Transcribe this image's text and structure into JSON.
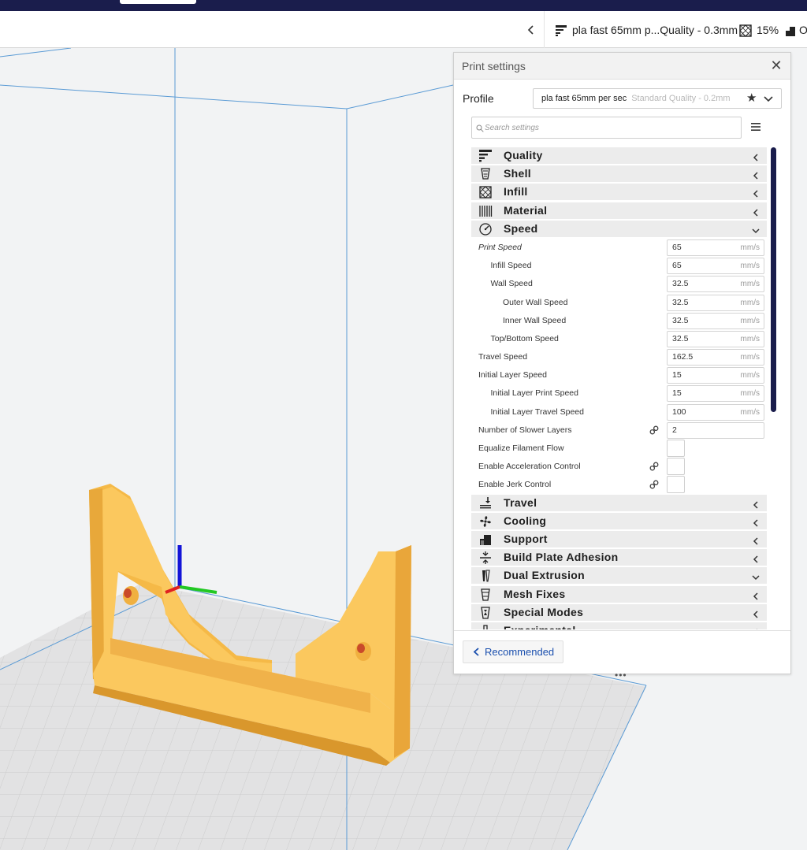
{
  "header": {
    "profile_summary": "pla fast 65mm p...Quality - 0.3mm",
    "infill_percent": "15%",
    "support_cut": "O"
  },
  "panel": {
    "title": "Print settings",
    "profile_label": "Profile",
    "profile_name": "pla fast 65mm per sec",
    "profile_sub": "Standard Quality - 0.2mm",
    "search_placeholder": "Search settings",
    "recommended_label": "Recommended",
    "categories_top": [
      {
        "label": "Quality",
        "icon": "quality-icon",
        "expanded": false
      },
      {
        "label": "Shell",
        "icon": "shell-icon",
        "expanded": false
      },
      {
        "label": "Infill",
        "icon": "infill-icon",
        "expanded": false
      },
      {
        "label": "Material",
        "icon": "material-icon",
        "expanded": false
      },
      {
        "label": "Speed",
        "icon": "speed-icon",
        "expanded": true
      }
    ],
    "speed_rows": [
      {
        "label": "Print Speed",
        "value": "65",
        "unit": "mm/s",
        "indent": 0,
        "italic": true
      },
      {
        "label": "Infill Speed",
        "value": "65",
        "unit": "mm/s",
        "indent": 1
      },
      {
        "label": "Wall Speed",
        "value": "32.5",
        "unit": "mm/s",
        "indent": 1
      },
      {
        "label": "Outer Wall Speed",
        "value": "32.5",
        "unit": "mm/s",
        "indent": 2
      },
      {
        "label": "Inner Wall Speed",
        "value": "32.5",
        "unit": "mm/s",
        "indent": 2
      },
      {
        "label": "Top/Bottom Speed",
        "value": "32.5",
        "unit": "mm/s",
        "indent": 1
      },
      {
        "label": "Travel Speed",
        "value": "162.5",
        "unit": "mm/s",
        "indent": 0
      },
      {
        "label": "Initial Layer Speed",
        "value": "15",
        "unit": "mm/s",
        "indent": 0
      },
      {
        "label": "Initial Layer Print Speed",
        "value": "15",
        "unit": "mm/s",
        "indent": 1
      },
      {
        "label": "Initial Layer Travel Speed",
        "value": "100",
        "unit": "mm/s",
        "indent": 1
      },
      {
        "label": "Number of Slower Layers",
        "value": "2",
        "unit": "",
        "indent": 0,
        "linked": true
      },
      {
        "label": "Equalize Filament Flow",
        "checkbox": true,
        "indent": 0
      },
      {
        "label": "Enable Acceleration Control",
        "checkbox": true,
        "indent": 0,
        "linked": true
      },
      {
        "label": "Enable Jerk Control",
        "checkbox": true,
        "indent": 0,
        "linked": true
      }
    ],
    "categories_bottom": [
      {
        "label": "Travel",
        "icon": "travel-icon",
        "expanded": false
      },
      {
        "label": "Cooling",
        "icon": "cooling-icon",
        "expanded": false
      },
      {
        "label": "Support",
        "icon": "support-icon",
        "expanded": false
      },
      {
        "label": "Build Plate Adhesion",
        "icon": "adhesion-icon",
        "expanded": false
      },
      {
        "label": "Dual Extrusion",
        "icon": "dual-extrusion-icon",
        "expanded": true
      },
      {
        "label": "Mesh Fixes",
        "icon": "mesh-fixes-icon",
        "expanded": false
      },
      {
        "label": "Special Modes",
        "icon": "special-modes-icon",
        "expanded": false
      },
      {
        "label": "Experimental",
        "icon": "experimental-icon",
        "expanded": false
      }
    ]
  },
  "colors": {
    "accent": "#1a1d4c",
    "model": "#f9c45a",
    "link_blue": "#1a4fae"
  }
}
